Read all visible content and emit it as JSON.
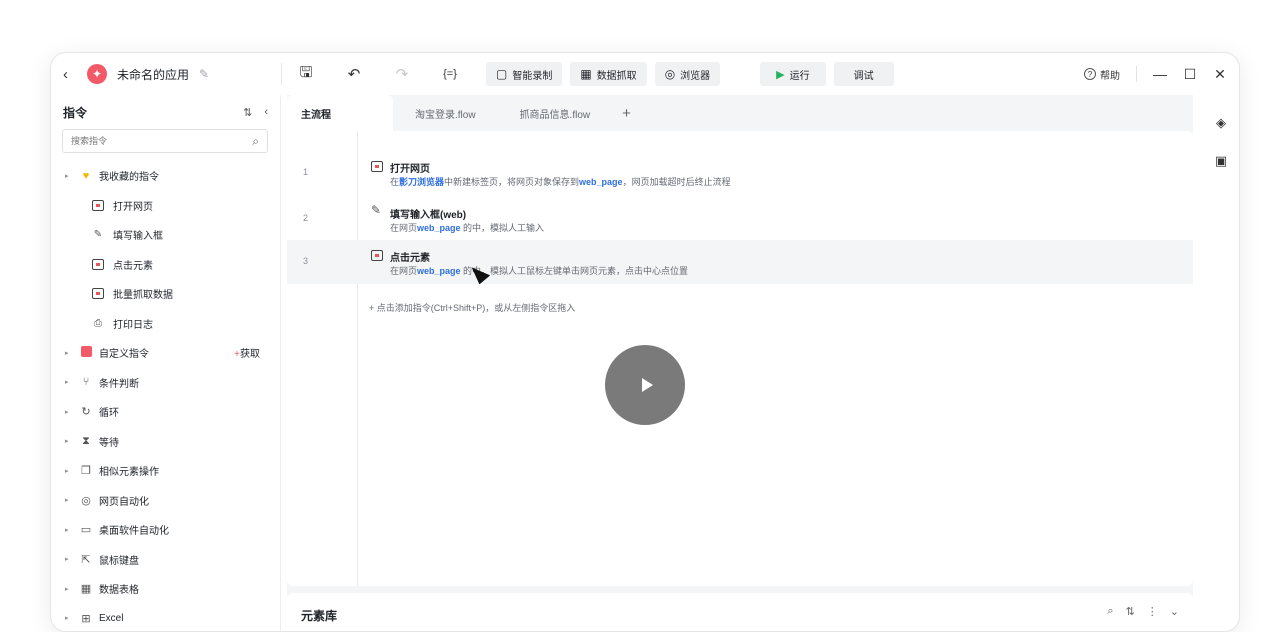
{
  "titlebar": {
    "back": "‹",
    "app_logo": "✦",
    "app_name": "未命名的应用",
    "edit": "✎",
    "tools": [
      "🖫",
      "↶",
      "↷",
      "{=}"
    ],
    "pills": [
      {
        "icon": "▢",
        "label": "智能录制"
      },
      {
        "icon": "▦",
        "label": "数据抓取"
      },
      {
        "icon": "◎",
        "label": "浏览器"
      }
    ],
    "run": {
      "icon": "▶",
      "label": "运行"
    },
    "debug": "调试",
    "help": {
      "icon": "?",
      "label": "帮助"
    },
    "win_controls": [
      "—",
      "☐",
      "✕"
    ]
  },
  "sidebar": {
    "title": "指令",
    "head_icons": [
      "⇅",
      "‹"
    ],
    "search_placeholder": "搜索指令",
    "search_icon": "⌕",
    "favorites": {
      "label": "我收藏的指令",
      "icon": "♥"
    },
    "favorite_items": [
      {
        "label": "打开网页",
        "icon": "box"
      },
      {
        "label": "填写输入框",
        "icon": "✎"
      },
      {
        "label": "点击元素",
        "icon": "box"
      },
      {
        "label": "批量抓取数据",
        "icon": "box"
      },
      {
        "label": "打印日志",
        "icon": "⎙"
      }
    ],
    "custom": {
      "label": "自定义指令",
      "get_plus": "+",
      "get_label": "获取"
    },
    "categories": [
      {
        "label": "条件判断",
        "icon": "⑂"
      },
      {
        "label": "循环",
        "icon": "↻"
      },
      {
        "label": "等待",
        "icon": "⧗"
      },
      {
        "label": "相似元素操作",
        "icon": "❐"
      },
      {
        "label": "网页自动化",
        "icon": "◎"
      },
      {
        "label": "桌面软件自动化",
        "icon": "▭"
      },
      {
        "label": "鼠标键盘",
        "icon": "⇱"
      },
      {
        "label": "数据表格",
        "icon": "▦"
      },
      {
        "label": "Excel",
        "icon": "⊞"
      }
    ]
  },
  "tabs": [
    {
      "label": "主流程",
      "active": true
    },
    {
      "label": "淘宝登录.flow"
    },
    {
      "label": "抓商品信息.flow"
    }
  ],
  "tab_add": "+",
  "steps": [
    {
      "num": "1",
      "title": "打开网页",
      "desc_parts": [
        "在",
        "影刀浏览器",
        "中新建标签页，将网页对象保存到",
        "web_page",
        "，网页加载超时后终止流程"
      ]
    },
    {
      "num": "2",
      "title": "填写输入框(web)",
      "desc_parts": [
        "在网页",
        "web_page",
        " 的中，模拟人工输入"
      ]
    },
    {
      "num": "3",
      "title": "点击元素",
      "desc_parts": [
        "在网页",
        "web_page",
        " 的中，模拟人工鼠标左键单击网页元素，点击中心点位置"
      ]
    }
  ],
  "add_hint": "+ 点击添加指令(Ctrl+Shift+P)，或从左侧指令区拖入",
  "element_lib": {
    "title": "元素库",
    "icons": [
      "⌕",
      "⇅",
      "⋮",
      "⌄"
    ]
  },
  "rightbar": {
    "icons": [
      "◈",
      "▣"
    ]
  }
}
